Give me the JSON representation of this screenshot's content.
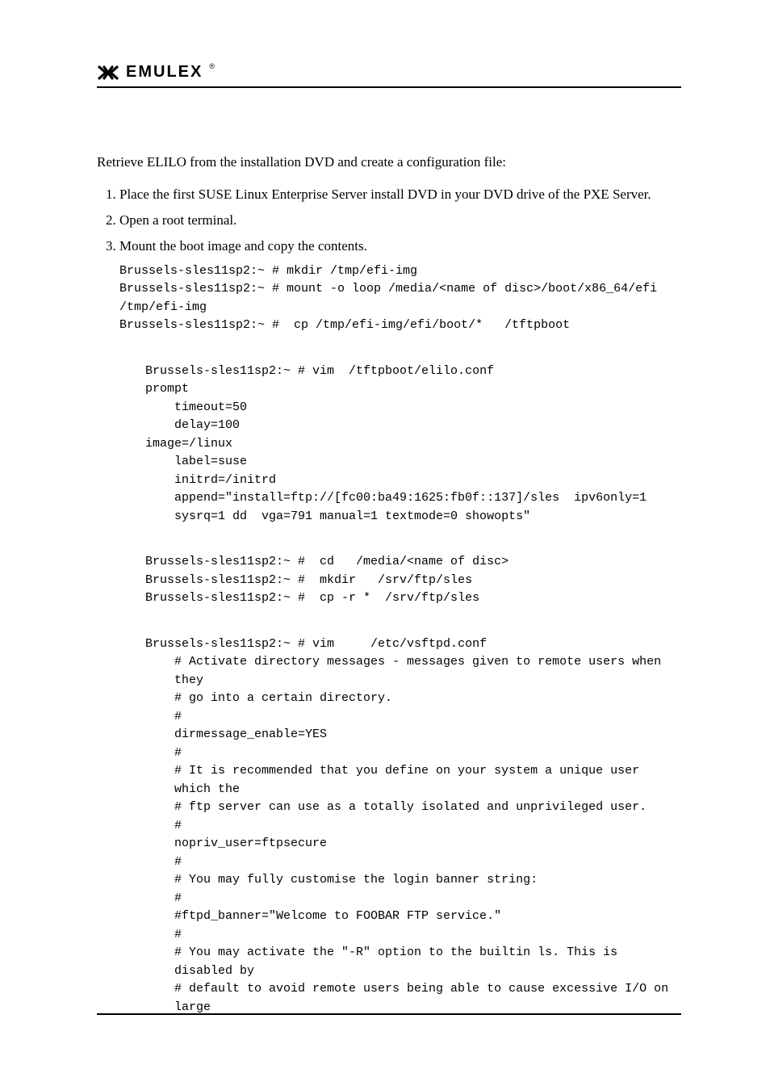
{
  "header": {
    "brand": "EMULEX"
  },
  "intro": "Retrieve ELILO from the installation DVD and create a configuration file:",
  "steps": [
    "Place the first SUSE Linux Enterprise Server install DVD in your DVD drive of the PXE Server.",
    "Open a root terminal.",
    "Mount the boot image and copy the contents."
  ],
  "code_step3": [
    "Brussels-sles11sp2:~ # mkdir /tmp/efi-img",
    "Brussels-sles11sp2:~ # mount -o loop /media/<name of disc>/boot/x86_64/efi /tmp/efi-img",
    "Brussels-sles11sp2:~ #  cp /tmp/efi-img/efi/boot/*   /tftpboot"
  ],
  "elilo_block": {
    "cmd": "Brussels-sles11sp2:~ # vim  /tftpboot/elilo.conf",
    "lines": [
      {
        "t": "prompt",
        "indent": false
      },
      {
        "t": "timeout=50",
        "indent": true
      },
      {
        "t": "delay=100",
        "indent": true
      },
      {
        "t": "image=/linux",
        "indent": false
      },
      {
        "t": "label=suse",
        "indent": true
      },
      {
        "t": "initrd=/initrd",
        "indent": true
      },
      {
        "t": "append=\"install=ftp://[fc00:ba49:1625:fb0f::137]/sles  ipv6only=1  sysrq=1 dd  vga=791 manual=1 textmode=0 showopts\"",
        "indent": true
      }
    ]
  },
  "copy_block": [
    "Brussels-sles11sp2:~ #  cd   /media/<name of disc>",
    "Brussels-sles11sp2:~ #  mkdir   /srv/ftp/sles",
    "Brussels-sles11sp2:~ #  cp -r *  /srv/ftp/sles"
  ],
  "vsftpd_block": {
    "cmd": "Brussels-sles11sp2:~ # vim     /etc/vsftpd.conf",
    "lines": [
      "# Activate directory messages - messages given to remote users when they",
      "# go into a certain directory.",
      "#",
      "dirmessage_enable=YES",
      "#",
      "# It is recommended that you define on your system a unique user which the",
      "# ftp server can use as a totally isolated and unprivileged user.",
      "#",
      "nopriv_user=ftpsecure",
      "#",
      "# You may fully customise the login banner string:",
      "#",
      "#ftpd_banner=\"Welcome to FOOBAR FTP service.\"",
      "#",
      "# You may activate the \"-R\" option to the builtin ls. This is disabled by",
      "# default to avoid remote users being able to cause excessive I/O on large"
    ]
  }
}
